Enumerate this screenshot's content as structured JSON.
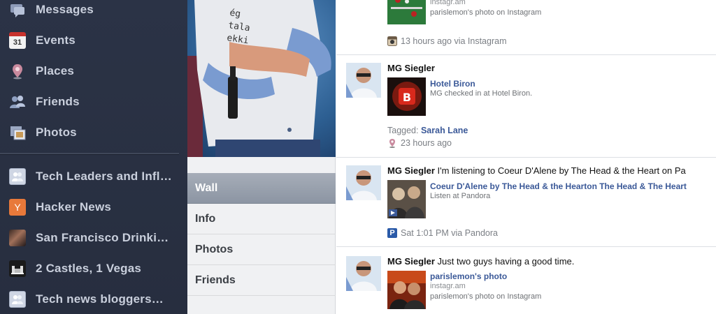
{
  "left_nav": {
    "items": [
      {
        "label": "Messages",
        "icon": "messages-icon"
      },
      {
        "label": "Events",
        "icon": "calendar-icon",
        "icon_text": "31"
      },
      {
        "label": "Places",
        "icon": "map-pin-icon"
      },
      {
        "label": "Friends",
        "icon": "friends-icon"
      },
      {
        "label": "Photos",
        "icon": "photos-icon"
      }
    ],
    "groups": [
      {
        "label": "Tech Leaders and Infl…",
        "icon": "group-icon"
      },
      {
        "label": "Hacker News",
        "icon": "hacker-news-icon",
        "icon_text": "Y"
      },
      {
        "label": "San Francisco Drinki…",
        "icon": "group-photo-icon"
      },
      {
        "label": "2 Castles, 1 Vegas",
        "icon": "group-photo-icon"
      },
      {
        "label": "Tech news bloggers…",
        "icon": "group-icon"
      }
    ]
  },
  "profile": {
    "shirt_text": "ég\ntala\nekki",
    "tabs": [
      "Wall",
      "Info",
      "Photos",
      "Friends"
    ],
    "active_tab": "Wall"
  },
  "feed": {
    "stories": [
      {
        "att_sub": "instagr.am",
        "att_desc": "parislemon's photo on Instagram",
        "meta": "13 hours ago via Instagram",
        "meta_icon": "instagram-icon"
      },
      {
        "author": "MG Siegler",
        "message": "",
        "att_title": "Hotel Biron",
        "att_desc": "MG checked in at Hotel Biron.",
        "tagged_label": "Tagged: ",
        "tagged_name": "Sarah Lane",
        "meta": "23 hours ago",
        "meta_icon": "map-pin-icon",
        "thumb_letter": "B"
      },
      {
        "author": "MG Siegler",
        "message": " I'm listening to Coeur D'Alene by The Head & the Heart on Pa",
        "att_title": "Coeur D'Alene by The Head & the Hearton The Head & The Heart",
        "att_desc": "Listen at Pandora",
        "meta": "Sat 1:01 PM via Pandora",
        "meta_icon": "pandora-icon",
        "meta_icon_text": "P"
      },
      {
        "author": "MG Siegler",
        "message": " Just two guys having a good time.",
        "att_title": "parislemon's photo",
        "att_sub": "instagr.am",
        "att_desc": "parislemon's photo on Instagram"
      }
    ]
  },
  "colors": {
    "nav_bg": "#2b3346",
    "link": "#3b5998",
    "active_tab": "#979fab",
    "hacker_news_orange": "#e8793a"
  }
}
